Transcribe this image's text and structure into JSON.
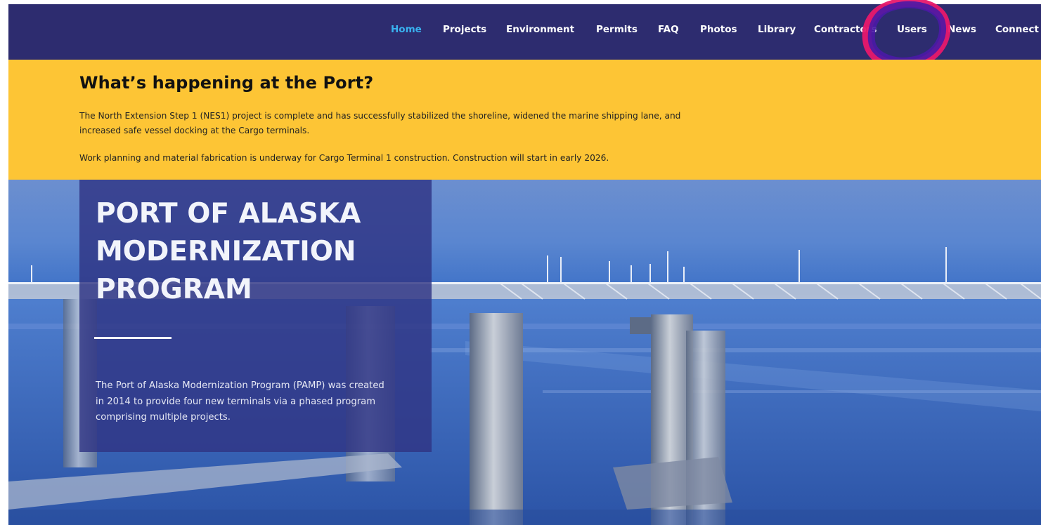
{
  "nav": {
    "items": [
      {
        "label": "Home",
        "active": true
      },
      {
        "label": "Projects",
        "active": false
      },
      {
        "label": "Environment",
        "active": false
      },
      {
        "label": "Permits",
        "active": false
      },
      {
        "label": "FAQ",
        "active": false
      },
      {
        "label": "Photos",
        "active": false
      },
      {
        "label": "Library",
        "active": false
      },
      {
        "label": "Contractors",
        "active": false
      },
      {
        "label": "Users",
        "active": false
      },
      {
        "label": "News",
        "active": false
      },
      {
        "label": "Connect",
        "active": false
      }
    ],
    "active_color": "#39b2f0",
    "bar_color": "#2d2c6f"
  },
  "notice": {
    "title": "What’s happening at the Port?",
    "paragraph_1_line_1": "The North Extension Step 1 (NES1) project is complete and has successfully stabilized the shoreline, widened the marine shipping lane, and",
    "paragraph_1_line_2": "increased safe vessel docking at the Cargo terminals.",
    "paragraph_2": "Work planning and material fabrication is underway for Cargo Terminal 1 construction. Construction will start in early 2026.",
    "background_color": "#fdc535"
  },
  "hero": {
    "title_line_1": "PORT OF ALASKA",
    "title_line_2": "MODERNIZATION",
    "title_line_3": "PROGRAM",
    "desc_line_1": "The Port of Alaska Modernization Program (PAMP) was created",
    "desc_line_2": "in 2014 to provide four new terminals via a phased program",
    "desc_line_3": "comprising multiple projects."
  }
}
